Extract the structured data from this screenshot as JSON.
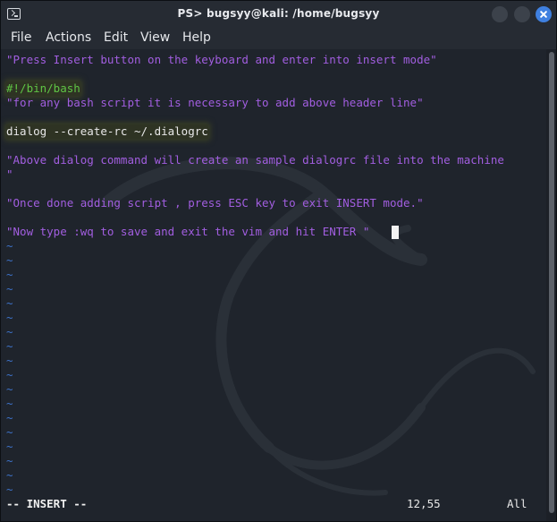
{
  "window": {
    "title": "PS> bugsyy@kali: /home/bugsyy",
    "accent_close": "#3f80e0"
  },
  "menu": {
    "items": [
      "File",
      "Actions",
      "Edit",
      "View",
      "Help"
    ]
  },
  "editor": {
    "lines": [
      "\"Press Insert button on the keyboard and enter into insert mode\"",
      "#!/bin/bash",
      "\"for any bash script it is necessary to add above header line\"",
      "dialog --create-rc ~/.dialogrc",
      "\"Above dialog command will create an sample dialogrc file into the machine",
      "\"",
      "\"Once done adding script , press ESC key to exit INSERT mode.\"",
      "\"Now type :wq to save and exit the vim and hit ENTER \""
    ],
    "tilde": "~",
    "colors": {
      "comment": "#a25ee0",
      "shebang": "#5fc545",
      "command": "#e8e8e8",
      "tilde": "#3d72c9"
    }
  },
  "status": {
    "mode": "-- INSERT --",
    "position": "12,55",
    "scroll": "All"
  }
}
